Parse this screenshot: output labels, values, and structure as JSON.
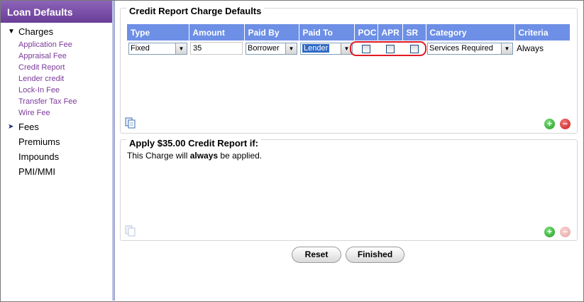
{
  "sidebar": {
    "title": "Loan Defaults",
    "charges_label": "Charges",
    "charges_items": [
      "Application Fee",
      "Appraisal Fee",
      "Credit Report",
      "Lender credit",
      "Lock-In Fee",
      "Transfer Tax Fee",
      "Wire Fee"
    ],
    "fees_label": "Fees",
    "other_items": [
      "Premiums",
      "Impounds",
      "PMI/MMI"
    ]
  },
  "panel1": {
    "title": "Credit Report Charge Defaults",
    "columns": [
      "Type",
      "Amount",
      "Paid By",
      "Paid To",
      "POC",
      "APR",
      "SR",
      "Category",
      "Criteria"
    ],
    "row": {
      "type": "Fixed",
      "amount": "35",
      "paid_by": "Borrower",
      "paid_to": "Lender",
      "poc": false,
      "apr": false,
      "sr": false,
      "category": "Services Required",
      "criteria": "Always"
    }
  },
  "panel2": {
    "title": "Apply $35.00 Credit Report if:",
    "desc_prefix": "This Charge will ",
    "desc_bold": "always",
    "desc_suffix": " be applied."
  },
  "buttons": {
    "reset": "Reset",
    "finished": "Finished"
  },
  "colors": {
    "header_purple": "#6a3d98",
    "grid_header_blue": "#6d8fe6",
    "link_purple": "#7b3a9a",
    "highlight_red": "#e01b24"
  }
}
